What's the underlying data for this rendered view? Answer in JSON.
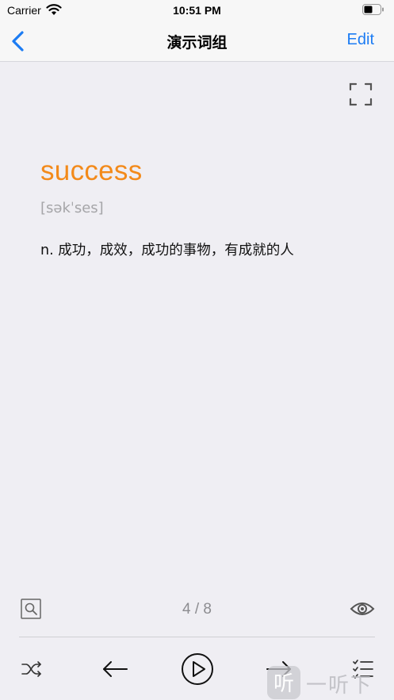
{
  "status_bar": {
    "carrier": "Carrier",
    "time": "10:51 PM"
  },
  "nav": {
    "title": "演示词组",
    "edit_label": "Edit"
  },
  "card": {
    "word": "success",
    "phonetic": "[səkˈses]",
    "definition": "n. 成功，成效，成功的事物，有成就的人"
  },
  "progress": "4 / 8",
  "watermark": {
    "logo_char": "听",
    "text": "一听下载"
  },
  "colors": {
    "accent": "#1c7cf3",
    "word": "#f38a1a",
    "background": "#efeef3"
  },
  "icons": {
    "back": "chevron-left-icon",
    "fullscreen": "fullscreen-icon",
    "search": "search-icon",
    "eye": "eye-icon",
    "shuffle": "shuffle-icon",
    "previous": "arrow-left-icon",
    "play": "play-icon",
    "next": "arrow-right-icon",
    "list": "list-icon"
  }
}
